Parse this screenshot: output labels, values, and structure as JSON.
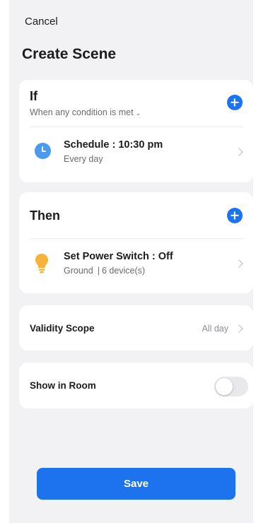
{
  "header": {
    "cancel_label": "Cancel",
    "title": "Create Scene"
  },
  "if_section": {
    "title": "If",
    "condition_label": "When any condition is met",
    "condition_chevron": "⌄",
    "add_icon": "plus-circle-icon",
    "item": {
      "icon": "clock-icon",
      "title": "Schedule : 10:30 pm",
      "subtitle": "Every day"
    }
  },
  "then_section": {
    "title": "Then",
    "add_icon": "plus-circle-icon",
    "item": {
      "icon": "lightbulb-icon",
      "title": "Set Power Switch : Off",
      "subtitle_room": "Ground",
      "subtitle_separator": "|",
      "subtitle_devices": "6 device(s)"
    }
  },
  "validity": {
    "label": "Validity Scope",
    "value": "All day"
  },
  "show_in_room": {
    "label": "Show in Room",
    "enabled": false
  },
  "footer": {
    "save_label": "Save"
  },
  "colors": {
    "accent": "#1d73ee",
    "clock": "#4a9bf0",
    "bulb": "#f6b33b",
    "background": "#f2f2f5"
  }
}
